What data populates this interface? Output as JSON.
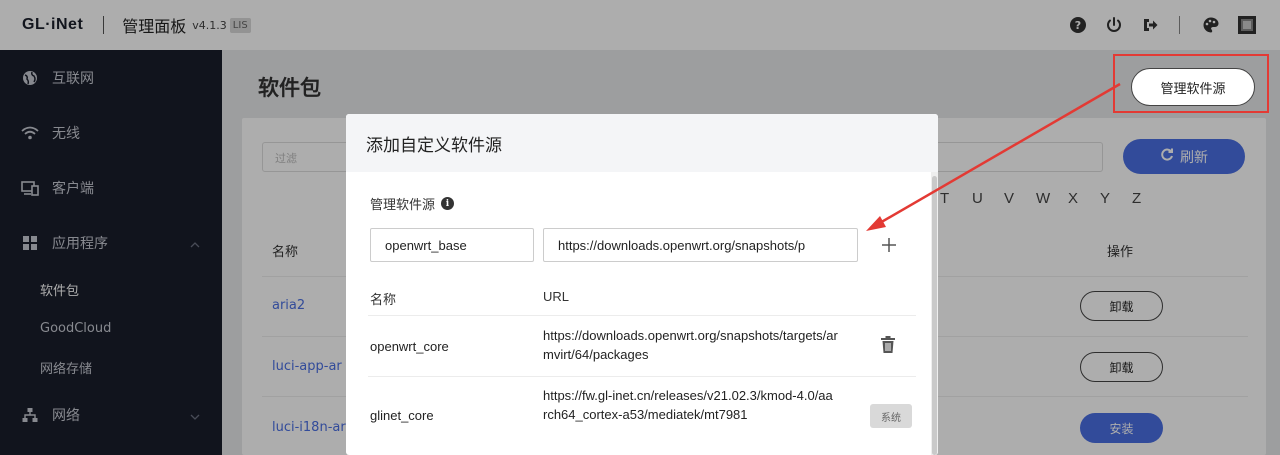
{
  "topbar": {
    "logo": "GL·iNet",
    "title": "管理面板",
    "version": "v4.1.3",
    "version_badge": "LIS",
    "icons": [
      "help-icon",
      "power-icon",
      "logout-icon",
      "palette-icon",
      "screen-icon"
    ]
  },
  "sidebar": {
    "items": [
      {
        "label": "互联网",
        "icon": "globe-icon"
      },
      {
        "label": "无线",
        "icon": "wifi-icon"
      },
      {
        "label": "客户端",
        "icon": "devices-icon"
      },
      {
        "label": "应用程序",
        "icon": "apps-icon"
      },
      {
        "label": "网络",
        "icon": "network-icon"
      }
    ],
    "subitems": [
      {
        "label": "软件包",
        "active": true
      },
      {
        "label": "GoodCloud",
        "active": false
      },
      {
        "label": "网络存储",
        "active": false
      }
    ]
  },
  "main": {
    "title": "软件包",
    "manage_button": "管理软件源",
    "search_placeholder": "过滤",
    "refresh_button": "刷新",
    "letters": [
      "T",
      "U",
      "V",
      "W",
      "X",
      "Y",
      "Z"
    ],
    "col_name": "名称",
    "col_op": "操作",
    "packages": [
      {
        "name": "aria2",
        "action": "卸载"
      },
      {
        "name": "luci-app-ar",
        "action": "卸载"
      },
      {
        "name": "luci-i18n-ar",
        "action": "安装"
      }
    ]
  },
  "modal": {
    "title": "添加自定义软件源",
    "section_label": "管理软件源",
    "name_input_value": "openwrt_base",
    "url_input_value": "https://downloads.openwrt.org/snapshots/p",
    "col_name": "名称",
    "col_url": "URL",
    "rows": [
      {
        "name": "openwrt_core",
        "url": "https://downloads.openwrt.org/snapshots/targets/armvirt/64/packages",
        "action": "delete"
      },
      {
        "name": "glinet_core",
        "url": "https://fw.gl-inet.cn/releases/v21.02.3/kmod-4.0/aarch64_cortex-a53/mediatek/mt7981",
        "action": "系统"
      }
    ]
  },
  "colors": {
    "accent": "#4a6fe3",
    "sidebar_bg": "#1a1e2b",
    "annotation": "#e33a34"
  }
}
